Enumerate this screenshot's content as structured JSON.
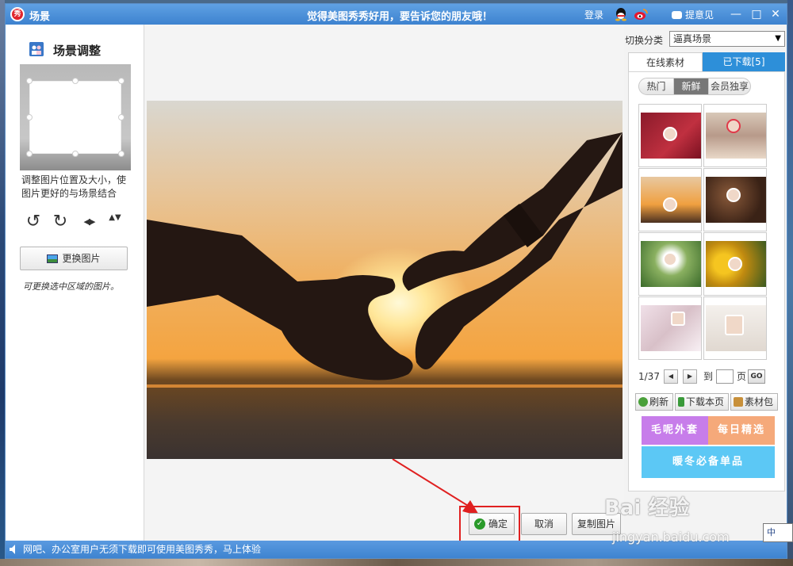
{
  "window": {
    "title": "场景",
    "logo_text": "秀",
    "slogan": "觉得美图秀秀好用，要告诉您的朋友哦！",
    "login": "登录",
    "feedback": "提意见",
    "min": "—",
    "max": "□",
    "close": "✕"
  },
  "left_panel": {
    "title": "场景调整",
    "hint": "调整图片位置及大小，使图片更好的与场景结合",
    "tools": {
      "rotate_left": "↺",
      "rotate_right": "↻",
      "flip_h": "◀▶",
      "flip_v": "▲▼"
    },
    "change_button": "更换图片",
    "note": "可更换选中区域的图片。"
  },
  "canvas": {
    "confirm_label": "确定",
    "cancel_label": "取消",
    "copy_label": "复制图片"
  },
  "right_panel": {
    "category_label": "切换分类",
    "category_value": "逼真场景",
    "tabs": {
      "online": "在线素材",
      "downloaded": "已下载[5]"
    },
    "subtabs": [
      "热门",
      "新鲜",
      "会员独享"
    ],
    "active_subtab": "新鲜",
    "pager": {
      "page": "1/37",
      "prev": "◀",
      "next": "▶",
      "to": "到",
      "page_unit": "页",
      "go": "GO",
      "input_value": ""
    },
    "actions": {
      "refresh": "刷新",
      "download_page": "下载本页",
      "material_pack": "素材包"
    },
    "banners": {
      "b1": "毛呢外套",
      "b2": "每日精选",
      "b3": "暖冬必备单品"
    }
  },
  "statusbar": {
    "text": "网吧、办公室用户无须下载即可使用美图秀秀，马上体验"
  },
  "watermark": {
    "main": "Bai 经验",
    "sub": "jingyan.baidu.com"
  },
  "ime": {
    "label": "中"
  },
  "colors": {
    "accent": "#3d82cf",
    "tab_active": "#2d8fd9",
    "highlight": "#e02020",
    "banner_purple": "#c77dea",
    "banner_orange": "#f5a97a",
    "banner_blue": "#5cc8f5"
  }
}
